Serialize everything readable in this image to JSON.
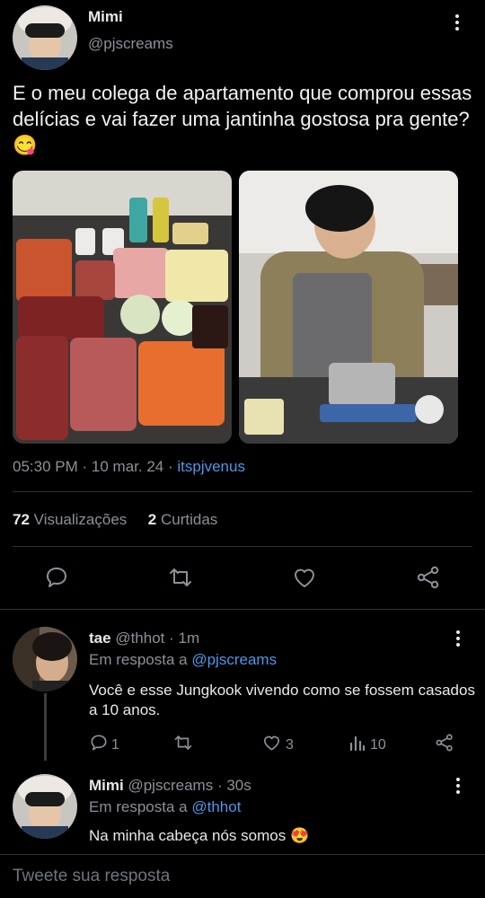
{
  "tweet": {
    "author_name": "Mimi",
    "author_handle": "@pjscreams",
    "text": "E o meu colega de apartamento que  comprou essas delícias e vai fazer uma jantinha gostosa pra gente? 😋",
    "time": "05:30 PM",
    "date": "10 mar. 24",
    "source": "itspjvenus",
    "views_count": "72",
    "views_label": "Visualizações",
    "likes_count": "2",
    "likes_label": "Curtidas"
  },
  "replies": [
    {
      "author_name": "tae",
      "author_handle": "@thhot",
      "time_ago": "1m",
      "reply_to_label": "Em resposta a",
      "reply_to_handle": "@pjscreams",
      "text": "Você e esse Jungkook vivendo como se fossem casados a 10 anos.",
      "replies_count": "1",
      "likes_count": "3",
      "views_count": "10"
    },
    {
      "author_name": "Mimi",
      "author_handle": "@pjscreams",
      "time_ago": "30s",
      "reply_to_label": "Em resposta a",
      "reply_to_handle": "@thhot",
      "text": "Na minha cabeça nós somos 😍"
    }
  ],
  "composer": {
    "placeholder": "Tweete sua resposta"
  },
  "separators": {
    "dot": "·"
  },
  "icons": [
    "more-icon",
    "reply-icon",
    "retweet-icon",
    "like-icon",
    "share-icon",
    "views-icon"
  ],
  "colors": {
    "background": "#000000",
    "link": "#4a98e9",
    "muted": "#8b9198",
    "divider": "#2f3336"
  }
}
